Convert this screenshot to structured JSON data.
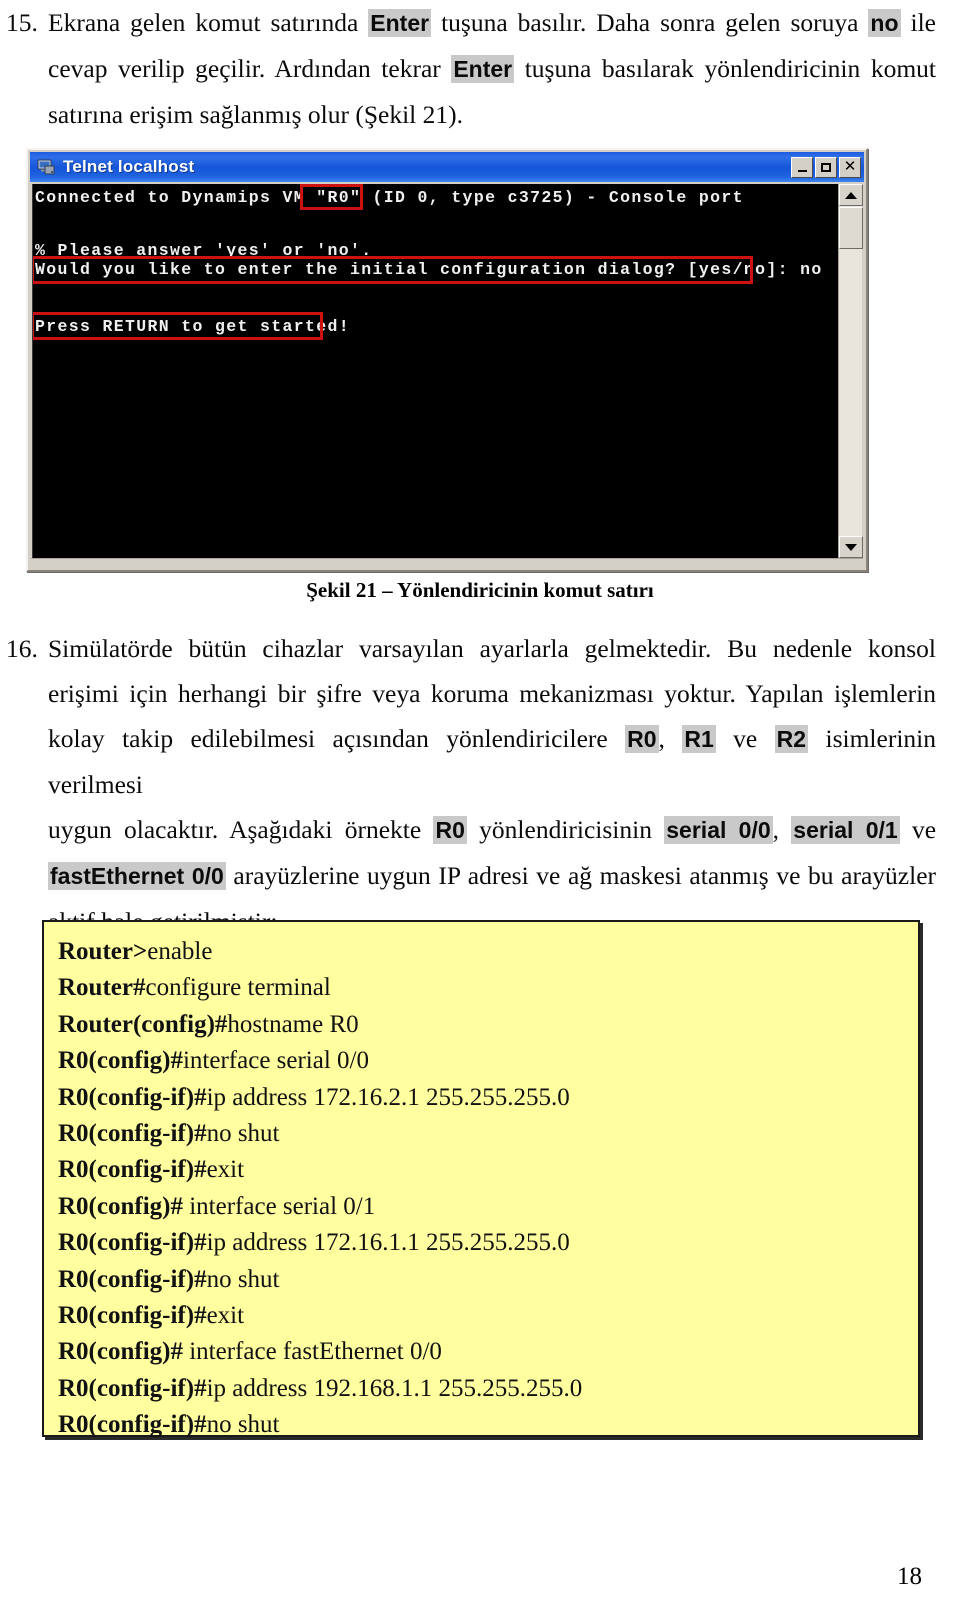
{
  "page": {
    "number": "18",
    "language": "tr"
  },
  "paragraph15": {
    "marker": "15.",
    "lines": [
      [
        {
          "t": "Ekrana gelen komut satırında ",
          "hl": false
        },
        {
          "t": "Enter",
          "hl": true
        },
        {
          "t": " tuşuna basılır. Daha sonra gelen soruya ",
          "hl": false
        },
        {
          "t": "no",
          "hl": true
        },
        {
          "t": " ile",
          "hl": false
        }
      ],
      [
        {
          "t": "cevap verilip geçilir. Ardından tekrar ",
          "hl": false
        },
        {
          "t": "Enter",
          "hl": true
        },
        {
          "t": " tuşuna basılarak yönlendiricinin komut",
          "hl": false
        }
      ],
      [
        {
          "t": "satırına erişim sağlanmış olur (Şekil 21).",
          "hl": false
        }
      ]
    ]
  },
  "telnet": {
    "title": "Telnet localhost",
    "icon": "computer-icon",
    "buttons": {
      "minimize": "minimize-button",
      "maximize": "maximize-button",
      "close": "close-button"
    },
    "close_glyph": "✕",
    "console_lines": [
      "Connected to Dynamips VM \"R0\" (ID 0, type c3725) - Console port",
      "",
      "% Please answer 'yes' or 'no'.",
      "Would you like to enter the initial configuration dialog? [yes/no]: no",
      "",
      "Press RETURN to get started!"
    ],
    "annotations": [
      {
        "label": "R0",
        "note": "red highlight box around router name"
      },
      {
        "label": "Would you like to enter the initial configuration dialog? [yes/no]: no",
        "note": "red highlight box around dialog answer line"
      },
      {
        "label": "Press RETURN to get started!",
        "note": "red highlight box around return prompt"
      }
    ],
    "scrollbar": {
      "up_arrow": "scroll-up-arrow",
      "down_arrow": "scroll-down-arrow",
      "thumb": "scroll-thumb"
    }
  },
  "figure": {
    "caption": "Şekil 21 – Yönlendiricinin komut satırı"
  },
  "paragraph16": {
    "marker": "16.",
    "lines": [
      [
        {
          "t": "Simülatörde bütün cihazlar varsayılan ayarlarla gelmektedir. Bu nedenle konsol",
          "hl": false
        }
      ],
      [
        {
          "t": "erişimi için herhangi bir şifre veya koruma mekanizması yoktur. Yapılan işlemlerin",
          "hl": false
        }
      ],
      [
        {
          "t": "kolay takip edilebilmesi açısından yönlendiricilere ",
          "hl": false
        },
        {
          "t": "R0",
          "hl": true
        },
        {
          "t": ", ",
          "hl": false
        },
        {
          "t": "R1",
          "hl": true
        },
        {
          "t": " ve ",
          "hl": false
        },
        {
          "t": "R2",
          "hl": true
        },
        {
          "t": " isimlerinin verilmesi",
          "hl": false
        }
      ],
      [
        {
          "t": "uygun olacaktır. Aşağıdaki örnekte ",
          "hl": false
        },
        {
          "t": "R0",
          "hl": true
        },
        {
          "t": " yönlendiricisinin ",
          "hl": false
        },
        {
          "t": "serial 0/0",
          "hl": true
        },
        {
          "t": ", ",
          "hl": false
        },
        {
          "t": "serial 0/1",
          "hl": true
        },
        {
          "t": " ve",
          "hl": false
        }
      ],
      [
        {
          "t": "fastEthernet 0/0",
          "hl": true
        },
        {
          "t": " arayüzlerine uygun IP adresi ve ağ maskesi atanmış ve bu arayüzler",
          "hl": false
        }
      ],
      [
        {
          "t": "aktif hale getirilmiştir:",
          "hl": false
        }
      ]
    ]
  },
  "codebox": {
    "background": "#ffffa0",
    "lines": [
      {
        "prompt": "Router>",
        "cmd": "enable"
      },
      {
        "prompt": "Router#",
        "cmd": "configure terminal"
      },
      {
        "prompt": "Router(config)#",
        "cmd": "hostname R0"
      },
      {
        "prompt": "R0(config)#",
        "cmd": "interface serial 0/0"
      },
      {
        "prompt": "R0(config-if)#",
        "cmd": "ip address 172.16.2.1 255.255.255.0"
      },
      {
        "prompt": "R0(config-if)#",
        "cmd": "no shut"
      },
      {
        "prompt": "R0(config-if)#",
        "cmd": "exit"
      },
      {
        "prompt": "R0(config)#",
        "cmd": " interface serial 0/1"
      },
      {
        "prompt": "R0(config-if)#",
        "cmd": "ip address 172.16.1.1 255.255.255.0"
      },
      {
        "prompt": "R0(config-if)#",
        "cmd": "no shut"
      },
      {
        "prompt": "R0(config-if)#",
        "cmd": "exit"
      },
      {
        "prompt": "R0(config)#",
        "cmd": " interface fastEthernet 0/0"
      },
      {
        "prompt": "R0(config-if)#",
        "cmd": "ip address 192.168.1.1 255.255.255.0"
      },
      {
        "prompt": "R0(config-if)#",
        "cmd": "no shut"
      }
    ]
  },
  "colors": {
    "highlight_bg": "#c9c9c9",
    "annotation_red": "#cc1111",
    "titlebar_blue": "#1b5ce0",
    "code_yellow": "#ffffa0"
  }
}
